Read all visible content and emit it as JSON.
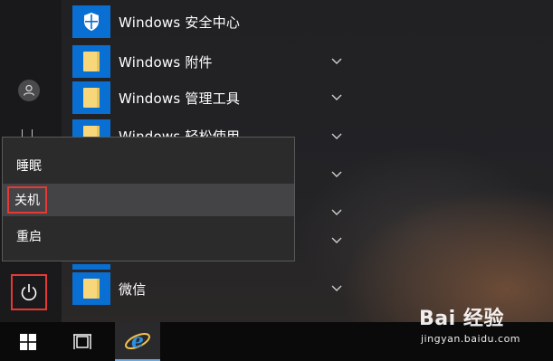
{
  "apps": [
    {
      "label": "Windows 安全中心",
      "icon": "shield-icon",
      "expandable": false
    },
    {
      "label": "Windows 附件",
      "icon": "folder-icon",
      "expandable": true
    },
    {
      "label": "Windows 管理工具",
      "icon": "folder-icon",
      "expandable": true
    },
    {
      "label": "Windows 轻松使用",
      "icon": "folder-icon",
      "expandable": true
    },
    {
      "label": "微信",
      "icon": "folder-icon",
      "expandable": true
    }
  ],
  "power_menu": {
    "items": [
      {
        "label": "睡眠"
      },
      {
        "label": "关机"
      },
      {
        "label": "重启"
      }
    ]
  },
  "watermark": {
    "brand": "Bai 经验",
    "domain": "jingyan.baidu.com"
  },
  "colors": {
    "tile": "#0a6fd2",
    "highlight_box": "#e53935",
    "menu_bg": "#2b2b2b"
  }
}
